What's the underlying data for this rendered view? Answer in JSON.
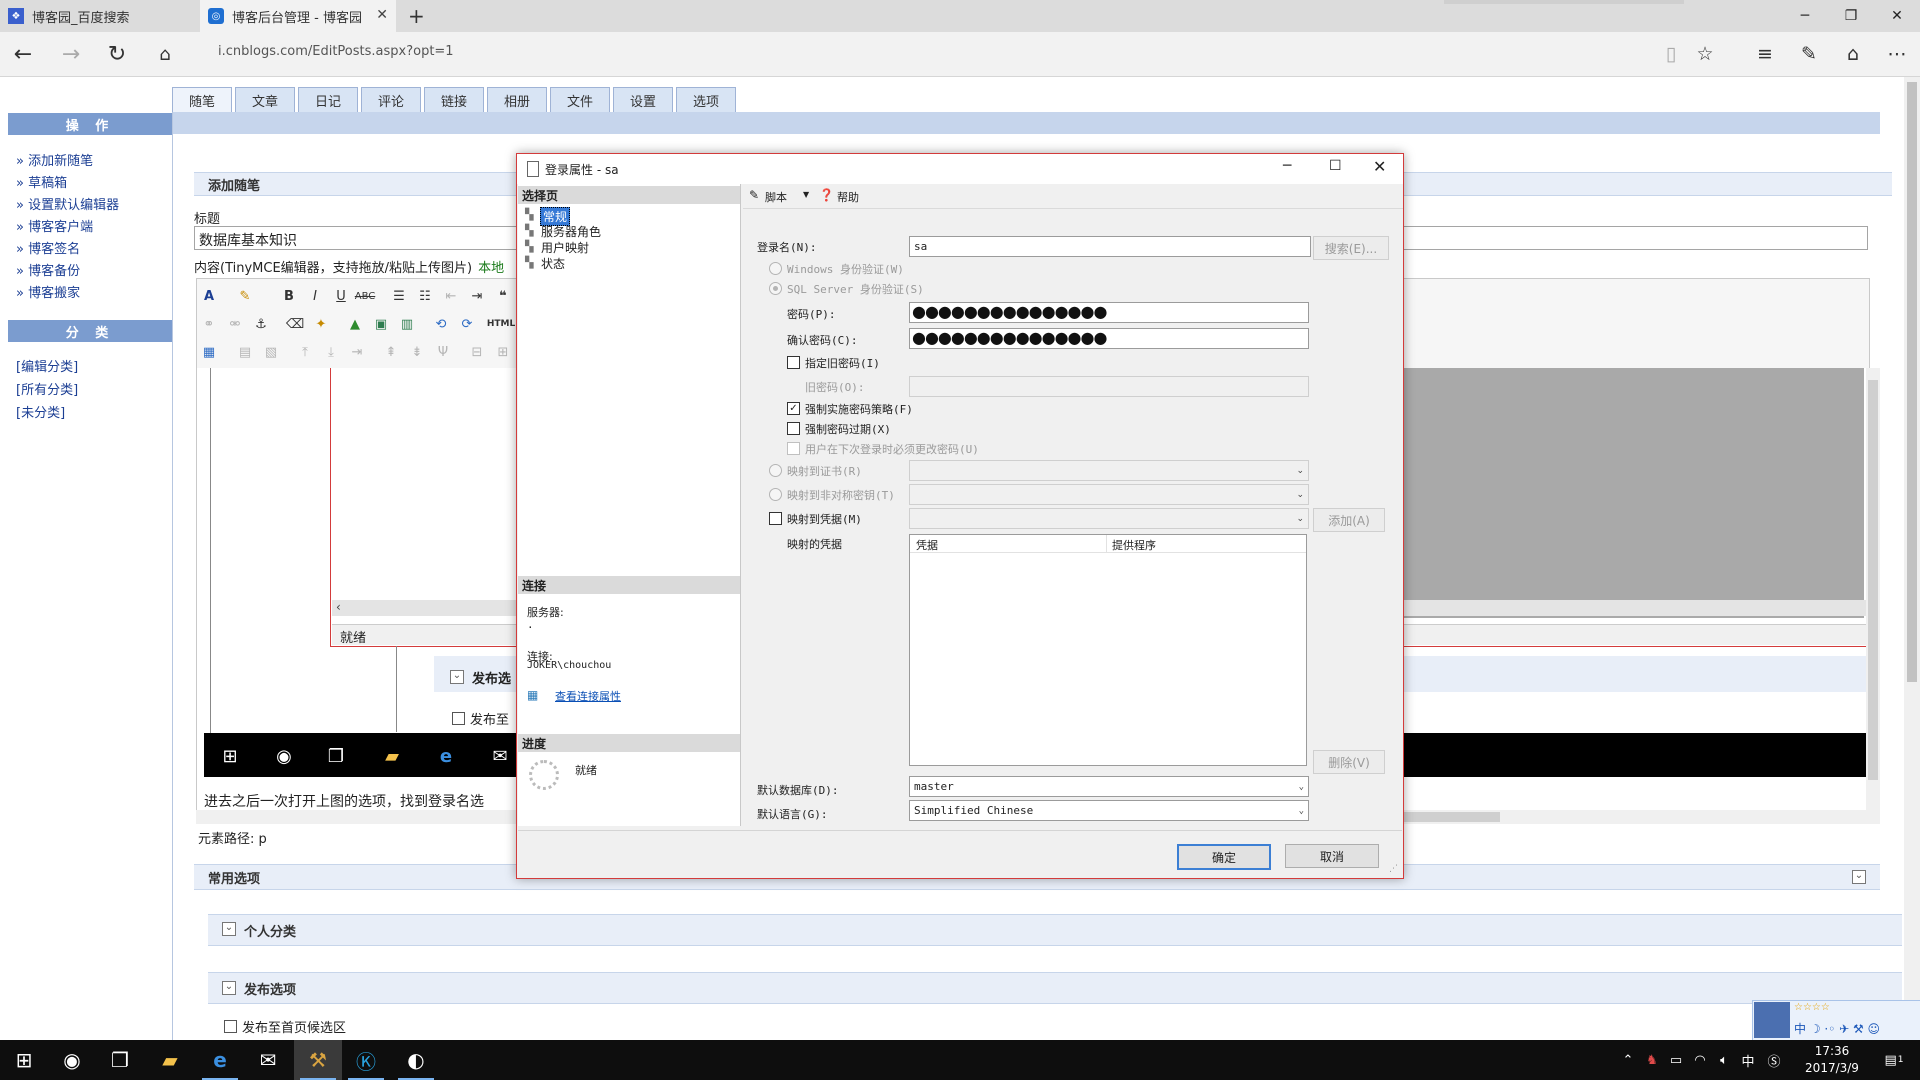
{
  "browser": {
    "tabs": [
      {
        "title": "博客园_百度搜索",
        "active": false
      },
      {
        "title": "博客后台管理 - 博客园",
        "active": true
      }
    ],
    "new_tab": "+",
    "url": "i.cnblogs.com/EditPosts.aspx?opt=1",
    "window_controls": {
      "minimize": "─",
      "restore": "❐",
      "close": "✕"
    }
  },
  "page": {
    "nav_tabs": [
      "随笔",
      "文章",
      "日记",
      "评论",
      "链接",
      "相册",
      "文件",
      "设置",
      "选项"
    ],
    "sidebar": {
      "ops_title": "操 作",
      "ops_links": [
        "» 添加新随笔",
        "» 草稿箱",
        "» 设置默认编辑器",
        "» 博客客户端",
        "» 博客签名",
        "» 博客备份",
        "» 博客搬家"
      ],
      "cat_title": "分 类",
      "cat_links": [
        "[编辑分类]",
        "[所有分类]",
        "[未分类]"
      ]
    },
    "editor": {
      "section_title": "添加随笔",
      "title_label": "标题",
      "title_value": "数据库基本知识",
      "content_label": "内容(TinyMCE编辑器，支持拖放/粘贴上传图片)",
      "content_local": "本地",
      "status": "就绪",
      "publish_options_inner": "发布选",
      "publish_to_inner": "发布至",
      "body_text": "进去之后一次打开上图的选项，找到登录名选",
      "element_path": "元素路径: p"
    },
    "common_options": {
      "title": "常用选项",
      "personal_category": "个人分类",
      "publish_options": "发布选项",
      "publish_home": "发布至首页候选区"
    }
  },
  "dialog": {
    "title": "登录属性 - sa",
    "select_page_title": "选择页",
    "pages": [
      "常规",
      "服务器角色",
      "用户映射",
      "状态"
    ],
    "toolbar": {
      "script": "脚本",
      "help": "帮助"
    },
    "login_name_label": "登录名(N):",
    "login_name_value": "sa",
    "search_button": "搜索(E)...",
    "windows_auth": "Windows 身份验证(W)",
    "sql_auth": "SQL Server 身份验证(S)",
    "password_label": "密码(P):",
    "password_value": "●●●●●●●●●●●●●●●",
    "confirm_label": "确认密码(C):",
    "confirm_value": "●●●●●●●●●●●●●●●",
    "specify_old": "指定旧密码(I)",
    "old_password_label": "旧密码(O):",
    "enforce_policy": "强制实施密码策略(F)",
    "enforce_expiration": "强制密码过期(X)",
    "must_change": "用户在下次登录时必须更改密码(U)",
    "map_cert": "映射到证书(R)",
    "map_asym": "映射到非对称密钥(T)",
    "map_cred": "映射到凭据(M)",
    "add_button": "添加(A)",
    "mapped_creds": "映射的凭据",
    "cred_columns": [
      "凭据",
      "提供程序"
    ],
    "delete_button": "删除(V)",
    "default_db_label": "默认数据库(D):",
    "default_db_value": "master",
    "default_lang_label": "默认语言(G):",
    "default_lang_value": "Simplified Chinese",
    "connection_title": "连接",
    "server_label": "服务器:",
    "server_value": ".",
    "connection_label": "连接:",
    "connection_value": "JOKER\\chouchou",
    "view_conn_props": "查看连接属性",
    "progress_title": "进度",
    "progress_status": "就绪",
    "ok_button": "确定",
    "cancel_button": "取消"
  },
  "taskbar": {
    "ime": "中",
    "time": "17:36",
    "date": "2017/3/9",
    "notify": "1"
  }
}
